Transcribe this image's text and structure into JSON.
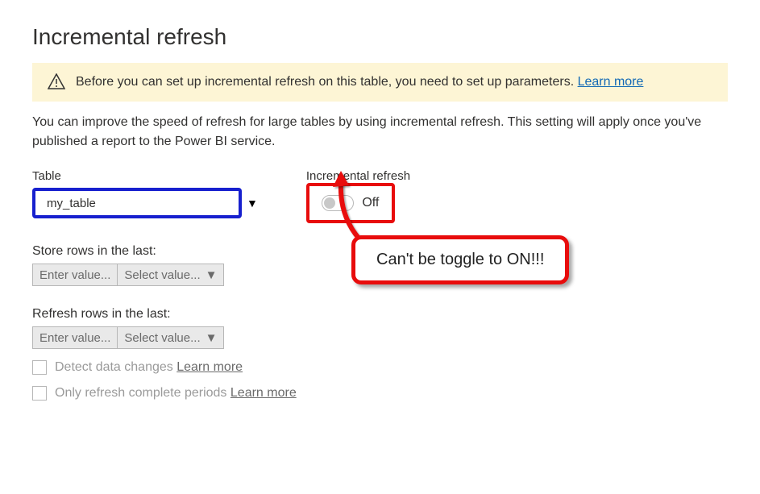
{
  "title": "Incremental refresh",
  "warning": {
    "text_pre": "Before you can set up incremental refresh on this table, you need to set up parameters. ",
    "learn_more": "Learn more"
  },
  "description": "You can improve the speed of refresh for large tables by using incremental refresh. This setting will apply once you've published a report to the Power BI service.",
  "table": {
    "label": "Table",
    "selected": "my_table"
  },
  "toggle": {
    "label": "Incremental refresh",
    "state_text": "Off"
  },
  "store": {
    "label": "Store rows in the last:",
    "value_placeholder": "Enter value...",
    "unit_placeholder": "Select value..."
  },
  "refresh": {
    "label": "Refresh rows in the last:",
    "value_placeholder": "Enter value...",
    "unit_placeholder": "Select value..."
  },
  "checks": {
    "detect": "Detect data changes",
    "detect_link": "Learn more",
    "only_complete": "Only refresh complete periods",
    "only_complete_link": "Learn more"
  },
  "annotation": {
    "callout": "Can't be toggle to ON!!!"
  }
}
